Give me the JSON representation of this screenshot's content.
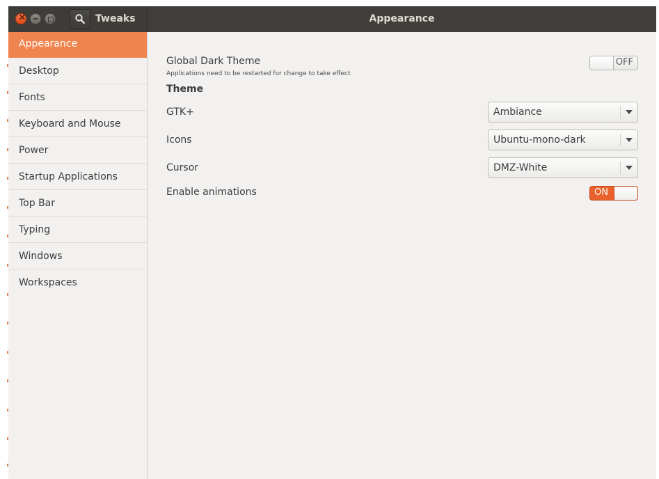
{
  "app": {
    "title": "Tweaks"
  },
  "header": {
    "title": "Appearance"
  },
  "sidebar": {
    "items": [
      {
        "label": "Appearance",
        "active": true
      },
      {
        "label": "Desktop"
      },
      {
        "label": "Fonts"
      },
      {
        "label": "Keyboard and Mouse"
      },
      {
        "label": "Power"
      },
      {
        "label": "Startup Applications"
      },
      {
        "label": "Top Bar"
      },
      {
        "label": "Typing"
      },
      {
        "label": "Windows"
      },
      {
        "label": "Workspaces"
      }
    ]
  },
  "main": {
    "dark_theme": {
      "label": "Global Dark Theme",
      "note": "Applications need to be restarted for change to take effect",
      "state": "OFF"
    },
    "theme_section": "Theme",
    "gtk": {
      "label": "GTK+",
      "value": "Ambiance"
    },
    "icons": {
      "label": "Icons",
      "value": "Ubuntu-mono-dark"
    },
    "cursor": {
      "label": "Cursor",
      "value": "DMZ-White"
    },
    "animations": {
      "label": "Enable animations",
      "state": "ON"
    }
  },
  "colors": {
    "accent": "#f0844e",
    "switch_on": "#e9622c",
    "titlebar": "#3d3c38"
  },
  "icons": {
    "close": "close-icon",
    "minimize": "minimize-icon",
    "maximize": "maximize-icon",
    "search": "search-icon",
    "dropdown": "chevron-down-icon"
  }
}
